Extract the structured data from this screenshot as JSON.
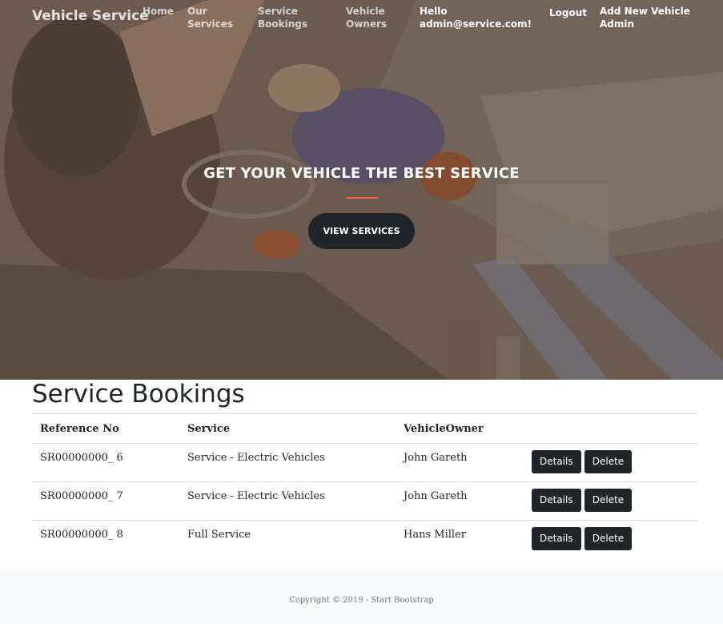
{
  "navbar": {
    "brand": "Vehicle Service",
    "links": [
      {
        "label": "Home"
      },
      {
        "label": "Our Services"
      },
      {
        "label": "Service Bookings"
      },
      {
        "label": "Vehicle Owners"
      },
      {
        "label": "Hello admin@service.com!"
      },
      {
        "label": "Logout"
      },
      {
        "label": "Add New Vehicle Admin"
      }
    ]
  },
  "hero": {
    "title": "GET YOUR VEHICLE THE BEST SERVICE",
    "button_label": "VIEW SERVICES",
    "divider_color": "#f05f40"
  },
  "bookings": {
    "title": "Service Bookings",
    "columns": [
      "Reference No",
      "Service",
      "VehicleOwner",
      ""
    ],
    "rows": [
      {
        "ref": "SR00000000_ 6",
        "service": "Service - Electric Vehicles",
        "owner": "John Gareth",
        "details": "Details",
        "delete": "Delete"
      },
      {
        "ref": "SR00000000_ 7",
        "service": "Service - Electric Vehicles",
        "owner": "John Gareth",
        "details": "Details",
        "delete": "Delete"
      },
      {
        "ref": "SR00000000_ 8",
        "service": "Full Service",
        "owner": "Hans Miller",
        "details": "Details",
        "delete": "Delete"
      }
    ]
  },
  "footer": {
    "text": "Copyright © 2019 - Start Bootstrap"
  }
}
